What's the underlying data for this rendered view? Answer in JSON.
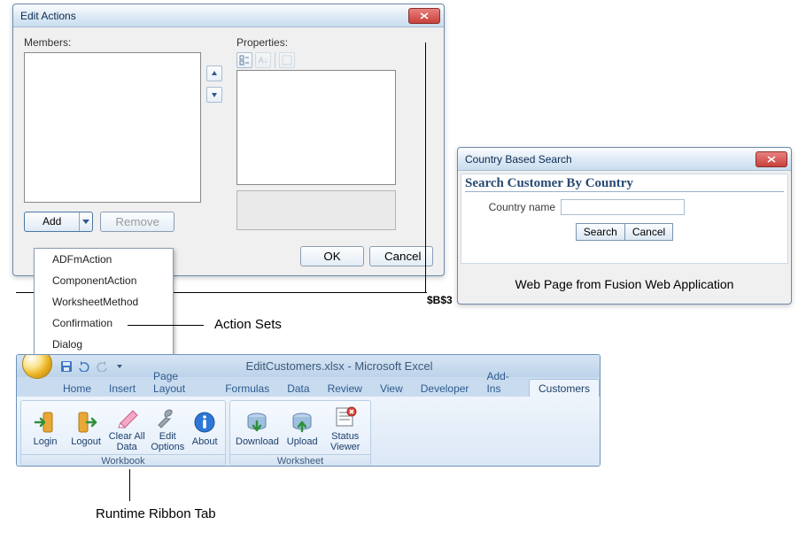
{
  "editActions": {
    "title": "Edit Actions",
    "membersLabel": "Members:",
    "propertiesLabel": "Properties:",
    "addLabel": "Add",
    "removeLabel": "Remove",
    "okLabel": "OK",
    "cancelLabel": "Cancel",
    "menu": [
      "ADFmAction",
      "ComponentAction",
      "WorksheetMethod",
      "Confirmation",
      "Dialog"
    ]
  },
  "cellRef": "$B$3",
  "annotations": {
    "actionSets": "Action Sets",
    "runtimeRibbon": "Runtime Ribbon Tab"
  },
  "countrySearch": {
    "title": "Country Based Search",
    "heading": "Search Customer By Country",
    "fieldLabel": "Country name",
    "search": "Search",
    "cancel": "Cancel",
    "caption": "Web Page from Fusion Web Application"
  },
  "excel": {
    "docTitle": "EditCustomers.xlsx - Microsoft Excel",
    "tabs": [
      "Home",
      "Insert",
      "Page Layout",
      "Formulas",
      "Data",
      "Review",
      "View",
      "Developer",
      "Add-Ins",
      "Customers"
    ],
    "activeTabIndex": 9,
    "groups": {
      "workbook": {
        "title": "Workbook",
        "items": [
          "Login",
          "Logout",
          "Clear All Data",
          "Edit Options",
          "About"
        ]
      },
      "worksheet": {
        "title": "Worksheet",
        "items": [
          "Download",
          "Upload",
          "Status Viewer"
        ]
      }
    }
  }
}
